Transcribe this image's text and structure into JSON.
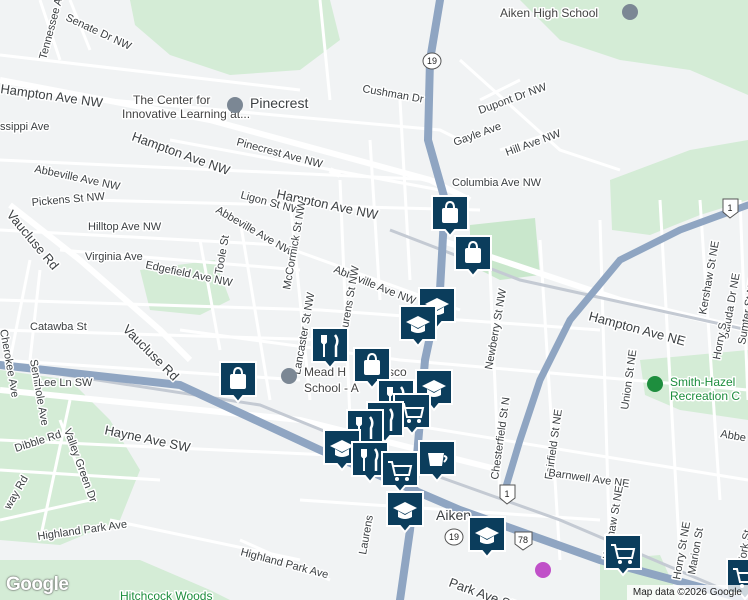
{
  "map": {
    "attribution": "Map data ©2026 Google",
    "logo_text": "Google",
    "colors": {
      "land": "#f1f3f4",
      "park": "#cfead3",
      "highway": "#8aa1bf",
      "road": "#ffffff",
      "rail": "#c3c9d1",
      "marker": "#0b3d5c"
    }
  },
  "labels": {
    "aiken_high_school": "Aiken High School",
    "senate_dr": "Senate Dr NW",
    "tennessee_ave": "Tennessee Ave NW",
    "cushman_dr": "Cushman Dr",
    "dupont_dr": "Dupont Dr NW",
    "hampton_ave_nw_top": "Hampton Ave NW",
    "center_line1": "The Center for",
    "center_line2": "Innovative Learning at...",
    "pinecrest": "Pinecrest",
    "mississippi_ave": "ssippi Ave",
    "gayle_ave": "Gayle Ave",
    "hill_ave": "Hill Ave NW",
    "pinecrest_ave": "Pinecrest Ave NW",
    "hampton_ave_nw_mid": "Hampton Ave NW",
    "columbia_ave": "Columbia Ave NW",
    "abbeville_ave_left": "Abbeville Ave NW",
    "pickens_st": "Pickens St NW",
    "ligon_st": "Ligon St NW",
    "hilltop_ave": "Hilltop Ave NW",
    "abbeville_ave_mid": "Abbeville Ave NW",
    "mccormick_st": "McCormick St NW",
    "vaucluse_rd_top": "Vaucluse Rd",
    "virginia_ave": "Virginia Ave",
    "toole_st": "Toole St",
    "edgefield_ave": "Edgefield Ave NW",
    "abbeville_ave_right": "Abbeville Ave NW",
    "hampton_ave_ne": "Hampton Ave NE",
    "kershaw_st_ne": "Kershaw St NE",
    "saluda_dr": "Saluda Dr NE",
    "sumter_st": "Sumter St NE",
    "horry_st_top": "Horry S",
    "seminole_ave": "Seminole Ave",
    "cherokee_ave": "Cherokee Ave",
    "catawba_st": "Catawba St",
    "lancaster_st": "Lancaster St NW",
    "laurens_st_nw": "Laurens St NW",
    "newberry_st": "Newberry St NW",
    "vaucluse_rd_mid": "Vaucluse Rd",
    "lee_ln": "Lee Ln SW",
    "mead_hall_line1": "Mead H",
    "mead_hall_line1b": "sco",
    "mead_hall_line2": "School - A",
    "smith_hazel_line1": "Smith-Hazel",
    "smith_hazel_line2": "Recreation C",
    "union_st": "Union St NE",
    "chesterfield_st": "Chesterfield St N",
    "fairfield_st": "Fairfield St NE",
    "abbe_right": "Abbe",
    "hayne_ave": "Hayne Ave SW",
    "dibble_rd": "Dibble Rd",
    "valley_green": "Valley Green Dr",
    "barnwell_ave": "Barnwell Ave NE",
    "kershaw_st_ne_low": "Kershaw St NE",
    "horry_st_low": "Horry St NE",
    "marion_st": "Marion St",
    "york_st": "York St",
    "way_rd": "way Rd",
    "aiken": "Aiken",
    "highland_park_ave_left": "Highland Park Ave",
    "highland_park_ave_low": "Highland Park Ave",
    "laurens_low": "Laurens",
    "park_ave": "Park Ave SE",
    "hitchcock": "Hitchcock Woods",
    "route_19_top": "19",
    "route_1_right": "1",
    "route_1_low": "1",
    "route_19_low": "19",
    "route_78": "78"
  },
  "markers": [
    {
      "name": "shopping-bag-marker",
      "icon": "shopping-bag-icon"
    },
    {
      "name": "shopping-bag-marker",
      "icon": "shopping-bag-icon"
    },
    {
      "name": "school-marker",
      "icon": "graduation-cap-icon"
    },
    {
      "name": "school-marker",
      "icon": "graduation-cap-icon"
    },
    {
      "name": "restaurant-marker",
      "icon": "fork-knife-icon"
    },
    {
      "name": "shopping-bag-marker",
      "icon": "shopping-bag-icon"
    },
    {
      "name": "shopping-bag-marker",
      "icon": "shopping-bag-icon"
    },
    {
      "name": "school-marker",
      "icon": "graduation-cap-icon"
    },
    {
      "name": "restaurant-marker",
      "icon": "fork-knife-icon"
    },
    {
      "name": "grocery-cart-marker",
      "icon": "shopping-cart-icon"
    },
    {
      "name": "restaurant-marker",
      "icon": "fork-knife-icon"
    },
    {
      "name": "restaurant-marker",
      "icon": "fork-knife-icon"
    },
    {
      "name": "school-marker",
      "icon": "graduation-cap-icon"
    },
    {
      "name": "restaurant-marker",
      "icon": "fork-knife-icon"
    },
    {
      "name": "grocery-cart-marker",
      "icon": "shopping-cart-icon"
    },
    {
      "name": "cafe-marker",
      "icon": "coffee-cup-icon"
    },
    {
      "name": "school-marker",
      "icon": "graduation-cap-icon"
    },
    {
      "name": "school-marker",
      "icon": "graduation-cap-icon"
    },
    {
      "name": "grocery-cart-marker",
      "icon": "shopping-cart-icon"
    },
    {
      "name": "grocery-cart-marker",
      "icon": "shopping-cart-icon"
    }
  ]
}
